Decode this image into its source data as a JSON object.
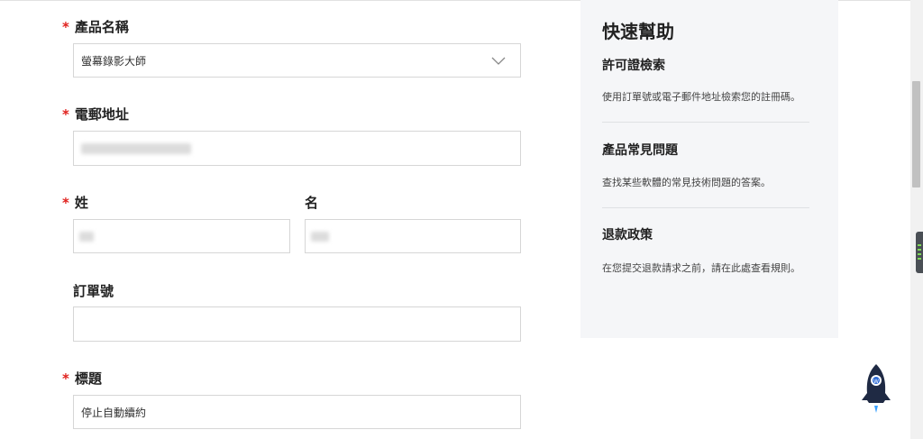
{
  "form": {
    "product": {
      "label": "產品名稱",
      "required": true,
      "value": "螢幕錄影大師"
    },
    "email": {
      "label": "電郵地址",
      "required": true,
      "value": ""
    },
    "last_name": {
      "label": "姓",
      "required": true,
      "value": ""
    },
    "first_name": {
      "label": "名",
      "required": false,
      "value": ""
    },
    "order_number": {
      "label": "訂單號",
      "required": false,
      "value": ""
    },
    "subject": {
      "label": "標題",
      "required": true,
      "value": "停止自動續約"
    },
    "required_mark": "*"
  },
  "help": {
    "title": "快速幫助",
    "sections": [
      {
        "heading": "許可證檢索",
        "text": "使用訂單號或電子郵件地址檢索您的註冊碼。"
      },
      {
        "heading": "產品常見問題",
        "text": "查找某些軟體的常見技術問題的答案。"
      },
      {
        "heading": "退款政策",
        "text": "在您提交退款請求之前，請在此處查看規則。"
      }
    ]
  },
  "colors": {
    "required": "#e0201c",
    "help_bg": "#f5f6f8",
    "border": "#d6d6d6",
    "rocket": "#1f2a44",
    "flame": "#3aa0ff"
  },
  "icons": {
    "dropdown": "chevron-down-icon",
    "launcher": "rocket-icon"
  }
}
